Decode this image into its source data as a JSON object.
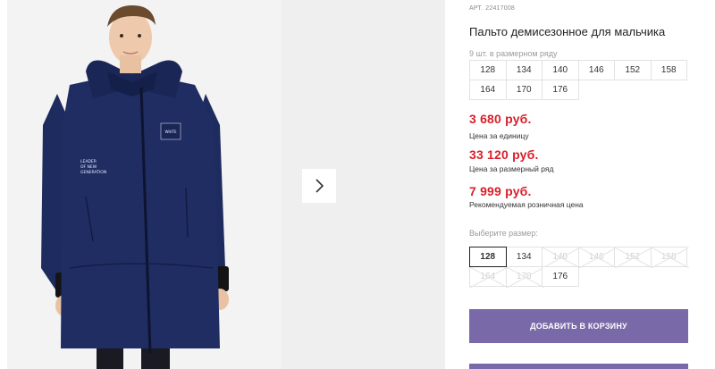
{
  "product": {
    "sku_label": "АРТ.",
    "sku": "22417008",
    "title": "Пальто демисезонное для мальчика",
    "row_note": "9 шт. в размерном ряду",
    "row_sizes": [
      [
        "128",
        "134",
        "140",
        "146",
        "152",
        "158"
      ],
      [
        "164",
        "170",
        "176"
      ]
    ],
    "prices": [
      {
        "value": "3 680 руб.",
        "caption": "Цена за единицу"
      },
      {
        "value": "33 120 руб.",
        "caption": "Цена за размерный ряд"
      },
      {
        "value": "7 999 руб.",
        "caption": "Рекомендуемая розничная цена"
      }
    ],
    "choose_size_label": "Выберите размер:",
    "pick_sizes": [
      [
        "128",
        "134",
        "140",
        "146",
        "152",
        "158"
      ],
      [
        "164",
        "170",
        "176"
      ]
    ],
    "selected_size": "128",
    "available_sizes": [
      "128",
      "134",
      "176"
    ],
    "add_to_cart_label": "ДОБАВИТЬ В КОРЗИНУ"
  },
  "gallery": {
    "next_icon": "chevron-right-icon",
    "jacket_badge_text": "LEADER OF NEW GENERATION",
    "jacket_patch_text": "WHITE"
  },
  "colors": {
    "price": "#d81f2a",
    "button": "#7a69a8",
    "jacket": "#1c2a5c",
    "page_bg": "#ffffff"
  }
}
